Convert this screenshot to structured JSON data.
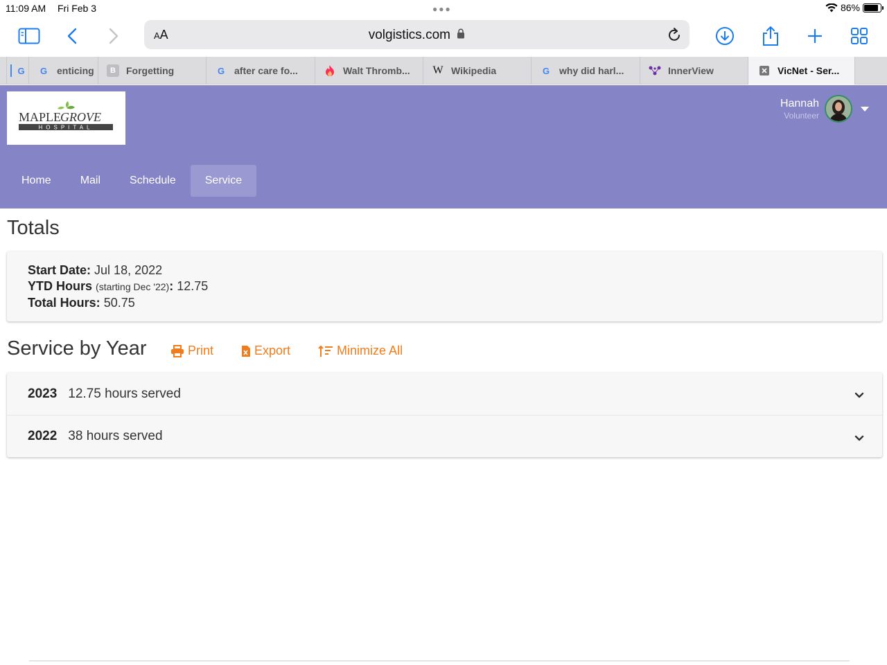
{
  "status": {
    "time": "11:09 AM",
    "date": "Fri Feb 3",
    "battery": "86%",
    "battery_level": 0.86
  },
  "browser": {
    "aa_small": "A",
    "aa_large": "A",
    "domain": "volgistics.com",
    "tabs": [
      {
        "label": "",
        "favicon": ""
      },
      {
        "label": "",
        "favicon": "G"
      },
      {
        "label": "enticing",
        "favicon": "G"
      },
      {
        "label": "Forgetting",
        "favicon": "B"
      },
      {
        "label": "after care fo...",
        "favicon": "G"
      },
      {
        "label": "Walt Thromb...",
        "favicon": "flame"
      },
      {
        "label": "Wikipedia",
        "favicon": "W"
      },
      {
        "label": "why did harl...",
        "favicon": "G"
      },
      {
        "label": "InnerView",
        "favicon": "network"
      },
      {
        "label": "VicNet - Ser...",
        "favicon": "close"
      }
    ]
  },
  "header": {
    "logo_line1": "MAPLE",
    "logo_line2": "GROVE",
    "logo_sub": "HOSPITAL",
    "user_name": "Hannah",
    "user_role": "Volunteer",
    "nav": [
      "Home",
      "Mail",
      "Schedule",
      "Service"
    ],
    "active_nav": "Service",
    "accent": "#8584c6"
  },
  "totals": {
    "heading": "Totals",
    "start_label": "Start Date:",
    "start_value": "Jul 18, 2022",
    "ytd_label": "YTD Hours",
    "ytd_note": "(starting Dec '22)",
    "ytd_value": "12.75",
    "total_label": "Total Hours:",
    "total_value": "50.75"
  },
  "service": {
    "heading": "Service by Year",
    "actions": {
      "print": "Print",
      "export": "Export",
      "minimize": "Minimize All"
    },
    "action_color": "#f07c1b",
    "years": [
      {
        "year": "2023",
        "summary": "12.75 hours served"
      },
      {
        "year": "2022",
        "summary": "38 hours served"
      }
    ]
  }
}
